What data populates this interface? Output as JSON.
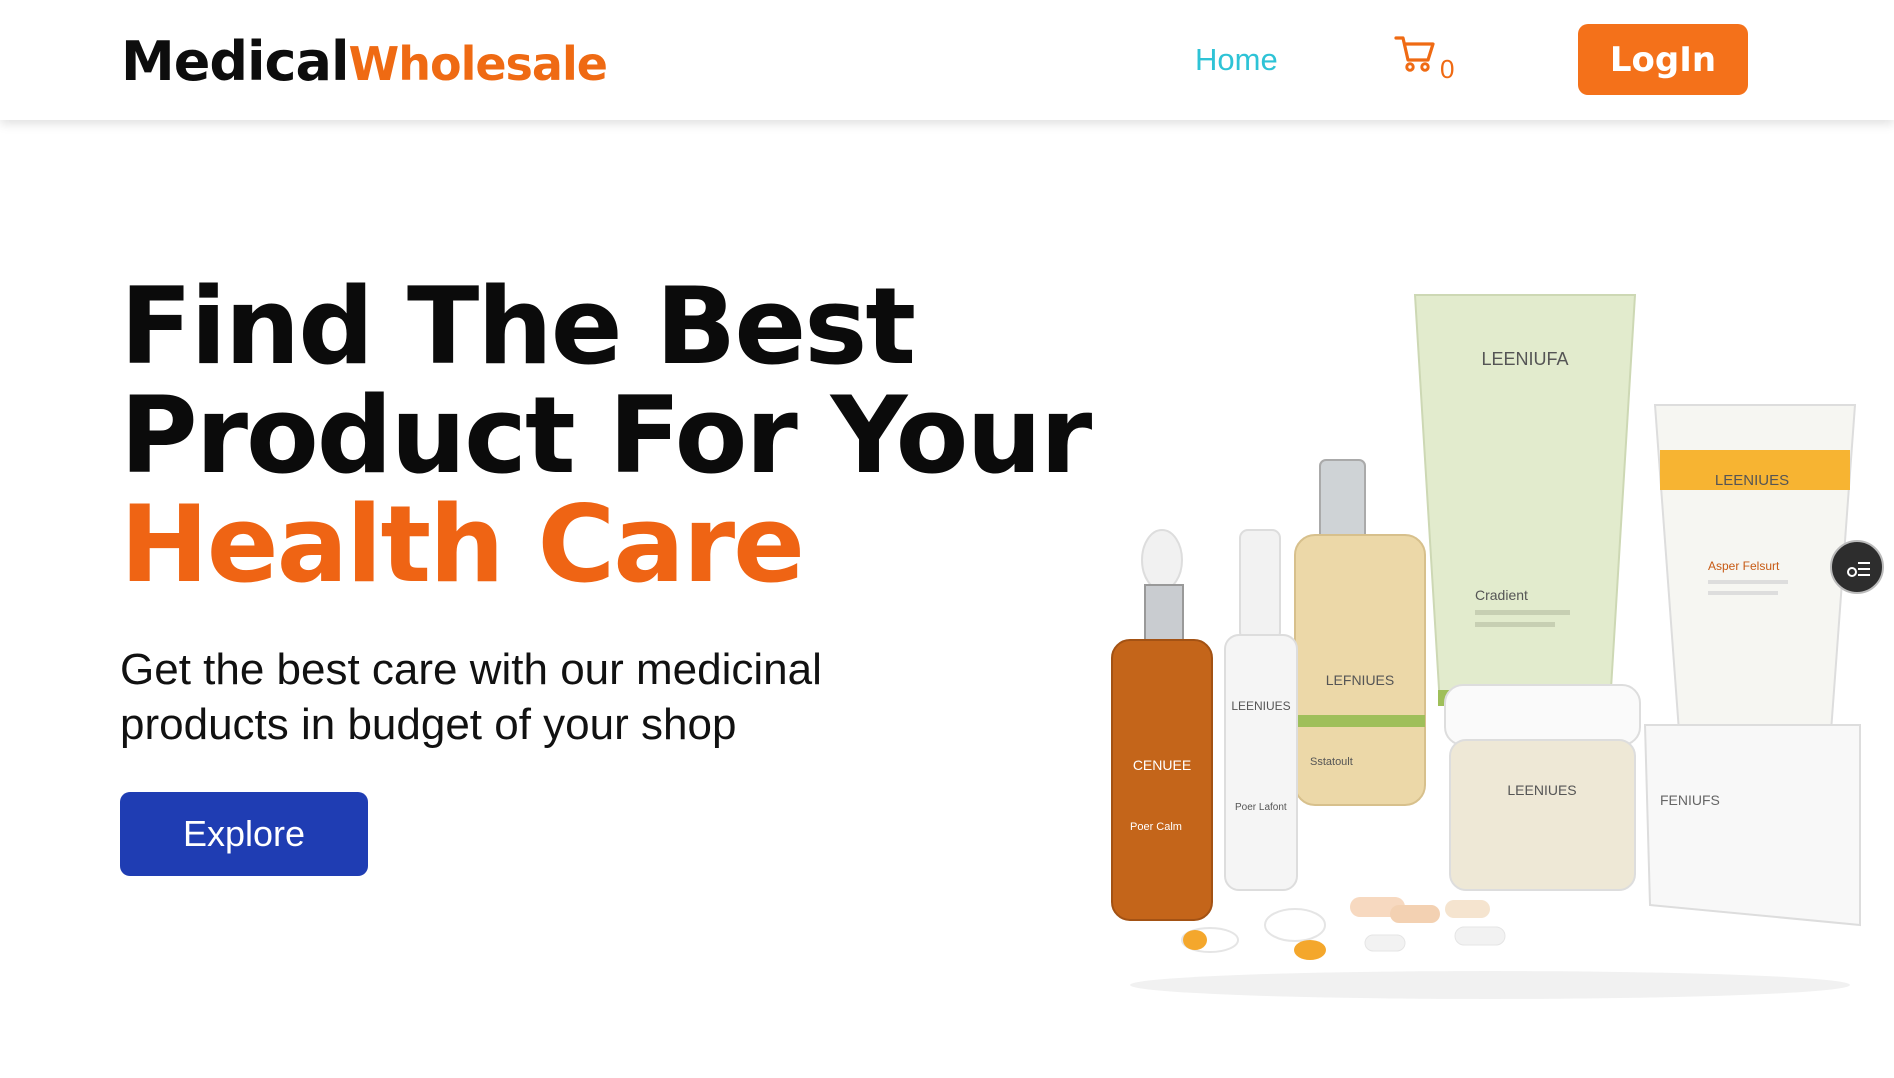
{
  "nav": {
    "brand_part1": "Medical",
    "brand_part2": "Wholesale",
    "home_label": "Home",
    "cart_count": "0",
    "login_label": "LogIn"
  },
  "hero": {
    "title_line1": "Find The Best",
    "title_line2": "Product For Your",
    "title_line3": "Health Care",
    "subtitle_line1": "Get the best care with our medicinal",
    "subtitle_line2": "products in budget of your shop",
    "explore_label": "Explore"
  },
  "products_image": {
    "label_tube_large": "LEENIUFA",
    "label_tube_large_sub": "Cradient",
    "label_tube_small": "LEENIUES",
    "label_tube_small_sub": "Asper Felsurt",
    "label_dropper": "CENUEE",
    "label_dropper_sub": "Poer Calm",
    "label_pump": "LEENIUES",
    "label_pump_sub": "Poer Lafont",
    "label_spray": "LEFNIUES",
    "label_spray_sub": "Sstatoult",
    "label_jar": "LEENIUES",
    "label_box": "FENIUFS"
  },
  "colors": {
    "accent_orange": "#ef6a13",
    "home_cyan": "#2ec3d6",
    "explore_blue": "#1f3db3"
  },
  "icons": {
    "cart": "cart-icon",
    "floating": "list-settings-icon"
  }
}
